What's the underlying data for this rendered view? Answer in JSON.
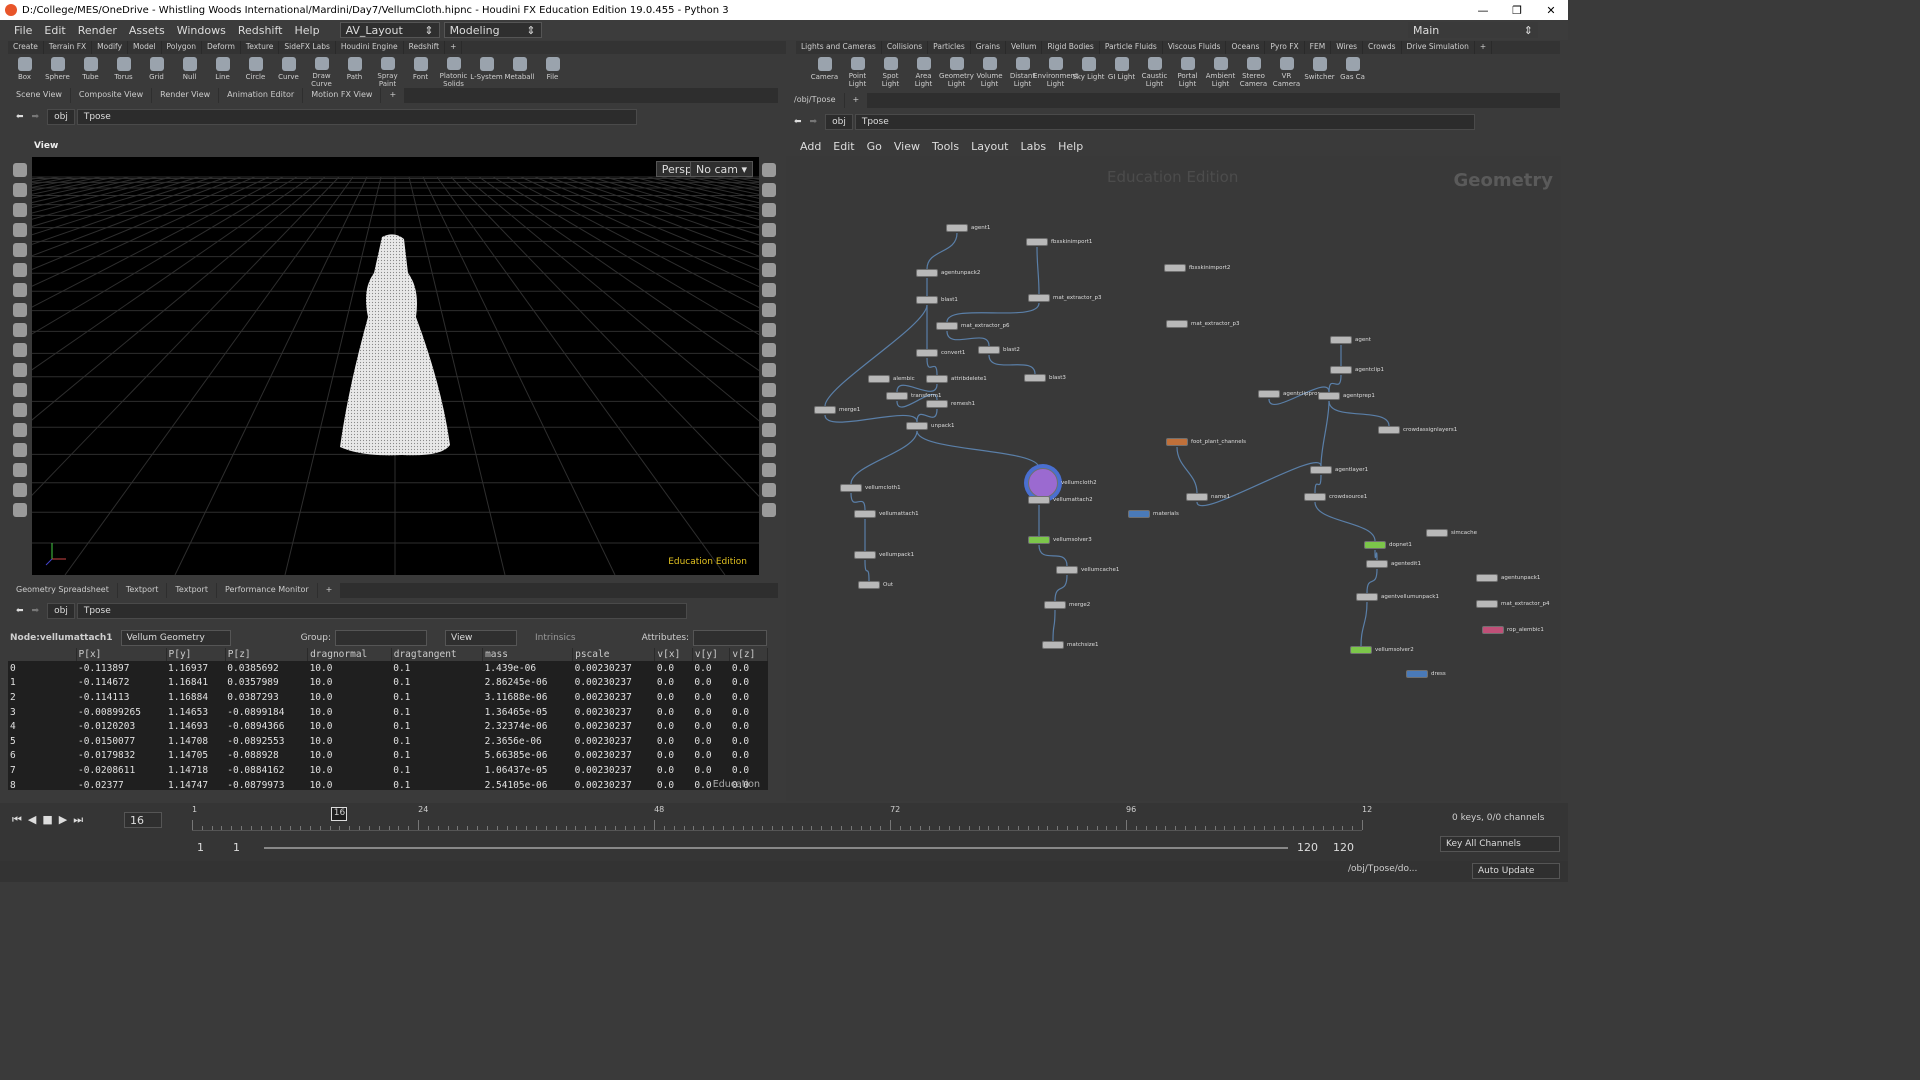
{
  "window": {
    "title": "D:/College/MES/OneDrive - Whistling Woods International/Mardini/Day7/VellumCloth.hipnc - Houdini FX Education Edition 19.0.455 - Python 3",
    "min": "—",
    "max": "❐",
    "close": "✕"
  },
  "menu": {
    "items": [
      "File",
      "Edit",
      "Render",
      "Assets",
      "Windows",
      "Redshift",
      "Help"
    ],
    "layout_combo": "AV_Layout",
    "desktop_combo": "Modeling",
    "main_combo": "Main"
  },
  "shelf_left": {
    "tabs": [
      "Create",
      "Terrain FX",
      "Modify",
      "Model",
      "Polygon",
      "Deform",
      "Texture",
      "SideFX Labs",
      "Houdini Engine",
      "Redshift"
    ],
    "tools": [
      "Box",
      "Sphere",
      "Tube",
      "Torus",
      "Grid",
      "Null",
      "Line",
      "Circle",
      "Curve",
      "Draw Curve",
      "Path",
      "Spray Paint",
      "Font",
      "Platonic Solids",
      "L-System",
      "Metaball",
      "File"
    ]
  },
  "shelf_right": {
    "tabs": [
      "Lights and Cameras",
      "Collisions",
      "Particles",
      "Grains",
      "Vellum",
      "Rigid Bodies",
      "Particle Fluids",
      "Viscous Fluids",
      "Oceans",
      "Pyro FX",
      "FEM",
      "Wires",
      "Crowds",
      "Drive Simulation"
    ],
    "tools": [
      "Camera",
      "Point Light",
      "Spot Light",
      "Area Light",
      "Geometry Light",
      "Volume Light",
      "Distant Light",
      "Environment Light",
      "Sky Light",
      "GI Light",
      "Caustic Light",
      "Portal Light",
      "Ambient Light",
      "Stereo Camera",
      "VR Camera",
      "Switcher",
      "Gas Ca"
    ]
  },
  "scene_tabs": [
    "Scene View",
    "Composite View",
    "Render View",
    "Animation Editor",
    "Motion FX View"
  ],
  "path": {
    "obj": "obj",
    "node": "Tpose"
  },
  "viewport": {
    "label": "View",
    "persp": "Persp ▾",
    "cam": "No cam ▾",
    "watermark": "Education Edition"
  },
  "lower_tabs": [
    "Geometry Spreadsheet",
    "Textport",
    "Textport",
    "Performance Monitor"
  ],
  "sheet": {
    "node_label": "Node:",
    "node": "vellumattach1",
    "type": "Vellum Geometry",
    "group": "Group:",
    "view": "View",
    "intrinsics": "Intrinsics",
    "attributes": "Attributes:",
    "columns": [
      "",
      "P[x]",
      "P[y]",
      "P[z]",
      "dragnormal",
      "dragtangent",
      "mass",
      "pscale",
      "v[x]",
      "v[y]",
      "v[z]"
    ],
    "rows": [
      [
        "0",
        "-0.113897",
        "1.16937",
        "0.0385692",
        "10.0",
        "0.1",
        "1.439e-06",
        "0.00230237",
        "0.0",
        "0.0",
        "0.0"
      ],
      [
        "1",
        "-0.114672",
        "1.16841",
        "0.0357989",
        "10.0",
        "0.1",
        "2.86245e-06",
        "0.00230237",
        "0.0",
        "0.0",
        "0.0"
      ],
      [
        "2",
        "-0.114113",
        "1.16884",
        "0.0387293",
        "10.0",
        "0.1",
        "3.11688e-06",
        "0.00230237",
        "0.0",
        "0.0",
        "0.0"
      ],
      [
        "3",
        "-0.00899265",
        "1.14653",
        "-0.0899184",
        "10.0",
        "0.1",
        "1.36465e-05",
        "0.00230237",
        "0.0",
        "0.0",
        "0.0"
      ],
      [
        "4",
        "-0.0120203",
        "1.14693",
        "-0.0894366",
        "10.0",
        "0.1",
        "2.32374e-06",
        "0.00230237",
        "0.0",
        "0.0",
        "0.0"
      ],
      [
        "5",
        "-0.0150077",
        "1.14708",
        "-0.0892553",
        "10.0",
        "0.1",
        "2.3656e-06",
        "0.00230237",
        "0.0",
        "0.0",
        "0.0"
      ],
      [
        "6",
        "-0.0179832",
        "1.14705",
        "-0.088928",
        "10.0",
        "0.1",
        "5.66385e-06",
        "0.00230237",
        "0.0",
        "0.0",
        "0.0"
      ],
      [
        "7",
        "-0.0208611",
        "1.14718",
        "-0.0884162",
        "10.0",
        "0.1",
        "1.06437e-05",
        "0.00230237",
        "0.0",
        "0.0",
        "0.0"
      ],
      [
        "8",
        "-0.02377",
        "1.14747",
        "-0.0879973",
        "10.0",
        "0.1",
        "2.54105e-06",
        "0.00230237",
        "0.0",
        "0.0",
        "0.0"
      ]
    ],
    "watermark": "Education"
  },
  "net_tab": "/obj/Tpose",
  "net_menu": [
    "Add",
    "Edit",
    "Go",
    "View",
    "Tools",
    "Layout",
    "Labs",
    "Help"
  ],
  "net": {
    "watermark": "Education Edition",
    "context": "Geometry",
    "nodes": [
      "agent1",
      "fbxskinimport1",
      "agentunpack2",
      "blast1",
      "mat_extractor_p3",
      "fbxskinimport2",
      "mat_extractor_p6",
      "mat_extractor_p3",
      "convert1",
      "blast2",
      "alembic",
      "attribdelete1",
      "blast3",
      "transform1",
      "remesh1",
      "merge1",
      "unpack1",
      "agent",
      "agentclip1",
      "agentclipprop",
      "agentprep1",
      "crowdassignlayers1",
      "foot_plant_channels",
      "vellumcloth2",
      "agentlayer1",
      "name1",
      "crowdsource1",
      "vellumcloth1",
      "vellumattach2",
      "materials",
      "vellumattach1",
      "vellumsolver3",
      "dopnet1",
      "simcache",
      "agentedit1",
      "vellumpack1",
      "vellumcache1",
      "agentunpack1",
      "Out",
      "merge2",
      "agentvellumunpack1",
      "mat_extractor_p4",
      "rop_alembic1",
      "matchsize1",
      "vellumsolver2",
      "dress"
    ]
  },
  "timeline": {
    "frame": "16",
    "ticks": [
      "1",
      "24",
      "48",
      "72",
      "96",
      "12"
    ],
    "start": "1",
    "start2": "1",
    "end": "120",
    "end2": "120",
    "keys": "0 keys, 0/0 channels",
    "keymode": "Key All Channels",
    "path": "/obj/Tpose/do...",
    "update": "Auto Update"
  }
}
